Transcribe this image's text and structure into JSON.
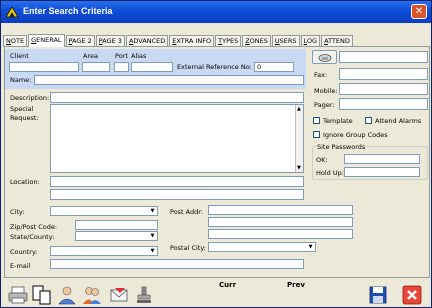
{
  "window": {
    "title": "Enter Search Criteria",
    "close_label": "✕"
  },
  "tabs": [
    {
      "label": "NOTE",
      "ul": "N",
      "rest": "OTE"
    },
    {
      "label": "GENERAL",
      "ul": "G",
      "rest": "ENERAL"
    },
    {
      "label": "PAGE 2",
      "ul": "P",
      "rest": "AGE 2"
    },
    {
      "label": "PAGE 3",
      "ul": "P",
      "rest": "AGE 3"
    },
    {
      "label": "ADVANCED",
      "ul": "A",
      "rest": "DVANCED"
    },
    {
      "label": "EXTRA INFO",
      "ul": "E",
      "rest": "XTRA INFO"
    },
    {
      "label": "TYPES",
      "ul": "T",
      "rest": "YPES"
    },
    {
      "label": "ZONES",
      "ul": "Z",
      "rest": "ONES"
    },
    {
      "label": "USERS",
      "ul": "U",
      "rest": "SERS"
    },
    {
      "label": "LOG",
      "ul": "L",
      "rest": "OG"
    },
    {
      "label": "ATTEND",
      "ul": "A",
      "rest": "TTEND"
    }
  ],
  "client": {
    "client_label": "Client",
    "area_label": "Area",
    "port_label": "Port",
    "alias_label": "Alias",
    "ext_ref_label": "External Reference No:",
    "ext_ref_value": "0",
    "name_label": "Name:"
  },
  "phones": {
    "fax_label": "Fax:",
    "mobile_label": "Mobile:",
    "pager_label": "Pager:"
  },
  "options": {
    "template_label": "Template",
    "attend_alarms_label": "Attend Alarms",
    "ignore_group_codes_label": "Ignore Group Codes"
  },
  "site_passwords": {
    "title": "Site Passwords",
    "ok_label": "OK:",
    "hold_up_label": "Hold Up:"
  },
  "details": {
    "description_label": "Description:",
    "special_request_label": "Special\nRequest:",
    "location_label": "Location:",
    "city_label": "City:",
    "zip_label": "Zip/Post Code:",
    "state_label": "State/County:",
    "country_label": "Country:",
    "email_label": "E-mail",
    "post_addr_label": "Post Addr:",
    "postal_city_label": "Postal City:"
  },
  "footer": {
    "curr_label": "Curr",
    "prev_label": "Prev"
  },
  "toolbar_icons": [
    "printer-icon",
    "copy-icon",
    "person-icon",
    "people-icon",
    "envelope-icon",
    "stamp-icon",
    "save-icon",
    "cancel-icon"
  ]
}
